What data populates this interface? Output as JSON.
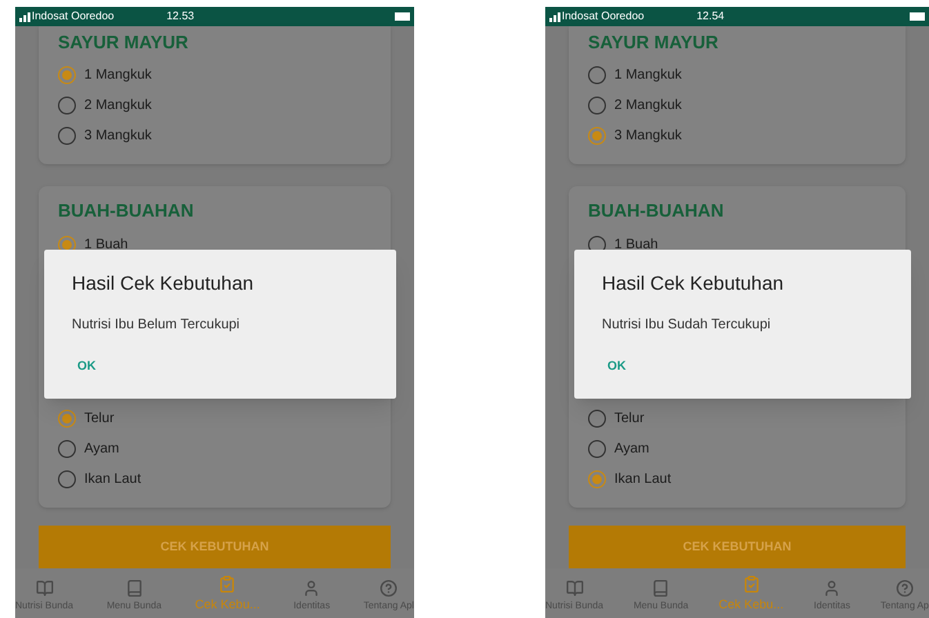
{
  "phones": [
    {
      "status": {
        "carrier": "Indosat Ooredoo",
        "time": "12.53"
      },
      "sections": [
        {
          "title": "SAYUR MAYUR",
          "options": [
            {
              "label": "1 Mangkuk",
              "selected": true
            },
            {
              "label": "2 Mangkuk",
              "selected": false
            },
            {
              "label": "3 Mangkuk",
              "selected": false
            }
          ]
        },
        {
          "title": "BUAH-BUAHAN",
          "options": [
            {
              "label": "1 Buah",
              "selected": true
            }
          ],
          "more_options": [
            {
              "label": "Telur",
              "selected": true
            },
            {
              "label": "Ayam",
              "selected": false
            },
            {
              "label": "Ikan Laut",
              "selected": false
            }
          ]
        }
      ],
      "button": "CEK KEBUTUHAN",
      "dialog": {
        "title": "Hasil Cek Kebutuhan",
        "message": "Nutrisi Ibu Belum Tercukupi",
        "ok": "OK"
      },
      "nav": [
        {
          "label": "Nutrisi Bunda",
          "selected": false
        },
        {
          "label": "Menu Bunda",
          "selected": false
        },
        {
          "label": "Cek Kebu...",
          "selected": true
        },
        {
          "label": "Identitas",
          "selected": false
        },
        {
          "label": "Tentang Apl",
          "selected": false
        }
      ]
    },
    {
      "status": {
        "carrier": "Indosat Ooredoo",
        "time": "12.54"
      },
      "sections": [
        {
          "title": "SAYUR MAYUR",
          "options": [
            {
              "label": "1 Mangkuk",
              "selected": false
            },
            {
              "label": "2 Mangkuk",
              "selected": false
            },
            {
              "label": "3 Mangkuk",
              "selected": true
            }
          ]
        },
        {
          "title": "BUAH-BUAHAN",
          "options": [
            {
              "label": "1 Buah",
              "selected": false
            }
          ],
          "more_options": [
            {
              "label": "Telur",
              "selected": false
            },
            {
              "label": "Ayam",
              "selected": false
            },
            {
              "label": "Ikan Laut",
              "selected": true
            }
          ]
        }
      ],
      "button": "CEK KEBUTUHAN",
      "dialog": {
        "title": "Hasil Cek Kebutuhan",
        "message": "Nutrisi Ibu Sudah Tercukupi",
        "ok": "OK"
      },
      "nav": [
        {
          "label": "Nutrisi Bunda",
          "selected": false
        },
        {
          "label": "Menu Bunda",
          "selected": false
        },
        {
          "label": "Cek Kebu...",
          "selected": true
        },
        {
          "label": "Identitas",
          "selected": false
        },
        {
          "label": "Tentang Ap",
          "selected": false
        }
      ]
    }
  ]
}
